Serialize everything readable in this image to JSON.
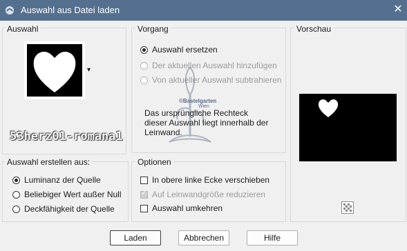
{
  "window": {
    "title": "Auswahl aus Datei laden",
    "close_label": "✕"
  },
  "auswahl": {
    "label": "Auswahl",
    "selection_name": "53herz01-romana1",
    "dropdown_arrow": "▾"
  },
  "vorgang": {
    "label": "Vorgang",
    "options": [
      {
        "label": "Auswahl ersetzen",
        "checked": true,
        "disabled": false
      },
      {
        "label": "Der aktuellen Auswahl hinzufügen",
        "checked": false,
        "disabled": true
      },
      {
        "label": "Von aktueller Auswahl subtrahieren",
        "checked": false,
        "disabled": true
      }
    ],
    "message": "Das ursprüngliche Rechteck dieser Auswahl liegt innerhalb der Leinwand."
  },
  "vorschau": {
    "label": "Vorschau"
  },
  "auswahl_erstellen": {
    "label": "Auswahl erstellen aus:",
    "options": [
      {
        "label": "Luminanz der Quelle",
        "checked": true
      },
      {
        "label": "Beliebiger Wert außer Null",
        "checked": false
      },
      {
        "label": "Deckfähigkeit der Quelle",
        "checked": false
      }
    ]
  },
  "optionen": {
    "label": "Optionen",
    "items": [
      {
        "label": "In obere linke Ecke verschieben",
        "checked": false,
        "disabled": false
      },
      {
        "label": "Auf Leinwandgröße reduzieren",
        "checked": true,
        "disabled": true
      },
      {
        "label": "Auswahl umkehren",
        "checked": false,
        "disabled": false
      }
    ]
  },
  "watermark": {
    "line1": "©Bastelgarten",
    "line2": "Wien"
  },
  "buttons": {
    "load": "Laden",
    "cancel": "Abbrechen",
    "help": "Hilfe"
  },
  "colors": {
    "titlebar": "#55708f",
    "dialog_bg": "#f0f0f0",
    "preview_bg": "#000000",
    "accent": "#ffffff"
  }
}
